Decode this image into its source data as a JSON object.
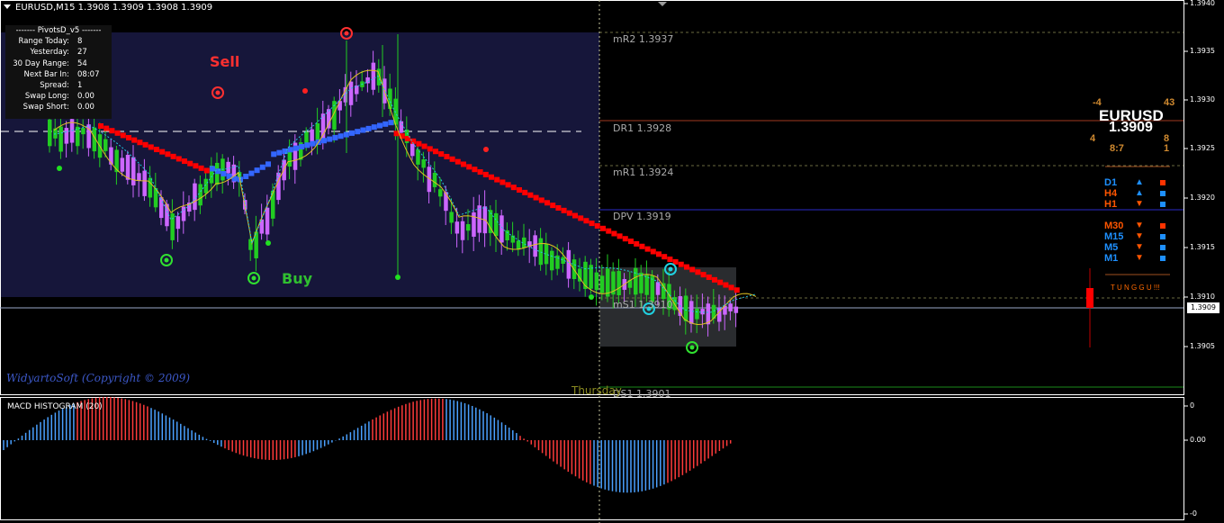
{
  "header": {
    "title": "EURUSD,M15  1.3908 1.3909 1.3908 1.3909"
  },
  "pivots_panel": {
    "heading": "-------  PivotsD_v5  -------",
    "rows": [
      {
        "label": "Range  Today:",
        "value": "8"
      },
      {
        "label": "Yesterday:",
        "value": "27"
      },
      {
        "label": "30 Day Range:",
        "value": "54"
      },
      {
        "label": "Next Bar In:",
        "value": "08:07"
      },
      {
        "label": "Spread:",
        "value": "1"
      },
      {
        "label": "Swap  Long:",
        "value": "0.00"
      },
      {
        "label": "Swap  Short:",
        "value": "0.00"
      }
    ]
  },
  "pivot_labels": {
    "mr2": "mR2  1.3937",
    "dr1": "DR1  1.3928",
    "mr1": "mR1  1.3924",
    "dpv": "DPV  1.3919",
    "ms1": "mS1  1.3910",
    "ds1": "DS1  1.3901"
  },
  "signals": {
    "sell": "Sell",
    "buy": "Buy"
  },
  "copyright": "WidyartoSoft (Copyright © 2009)",
  "day_label": "Thursday",
  "macd": {
    "label": "MACD HISTOGRAM (20)",
    "scale": [
      "0",
      "0.00",
      "-0"
    ]
  },
  "price_scale": [
    "1.3940",
    "1.3935",
    "1.3930",
    "1.3925",
    "1.3920",
    "1.3915",
    "1.3910",
    "1.3905"
  ],
  "current_price": "1.3909",
  "dashboard": {
    "top_left": "-4",
    "top_right": "43",
    "symbol": "EURUSD",
    "price": "1.3909",
    "left_num": "4",
    "ratio": "8:7",
    "right_a": "8",
    "right_b": "1",
    "timeframes": [
      {
        "name": "D1",
        "color": "#1e90ff",
        "dir": "up",
        "arrow": "▲",
        "arrow_color": "#1e90ff",
        "box_color": "#ff3300"
      },
      {
        "name": "H4",
        "color": "#ff5500",
        "dir": "up",
        "arrow": "▲",
        "arrow_color": "#1e90ff",
        "box_color": "#1e90ff"
      },
      {
        "name": "H1",
        "color": "#ff5500",
        "dir": "down",
        "arrow": "▼",
        "arrow_color": "#ff5500",
        "box_color": "#1e90ff"
      },
      {
        "name": "M30",
        "color": "#ff5500",
        "dir": "down",
        "arrow": "▼",
        "arrow_color": "#ff5500",
        "box_color": "#ff3300"
      },
      {
        "name": "M15",
        "color": "#1e90ff",
        "dir": "down",
        "arrow": "▼",
        "arrow_color": "#ff5500",
        "box_color": "#1e90ff"
      },
      {
        "name": "M5",
        "color": "#1e90ff",
        "dir": "down",
        "arrow": "▼",
        "arrow_color": "#ff5500",
        "box_color": "#1e90ff"
      },
      {
        "name": "M1",
        "color": "#1e90ff",
        "dir": "down",
        "arrow": "▼",
        "arrow_color": "#ff5500",
        "box_color": "#1e90ff"
      }
    ],
    "status": "T U N G G U !!!"
  },
  "colors": {
    "bull_candle": "#22cc22",
    "bear_candle": "#cc66ff",
    "dn_trail": "#ff0000",
    "up_trail": "#3366ff",
    "macd_pos": "#4aa0ff",
    "macd_neg": "#ff3b3b",
    "session_box": "#16163a",
    "yellow_ma": "#e0c020",
    "cyan_ma": "#22c8e0"
  }
}
